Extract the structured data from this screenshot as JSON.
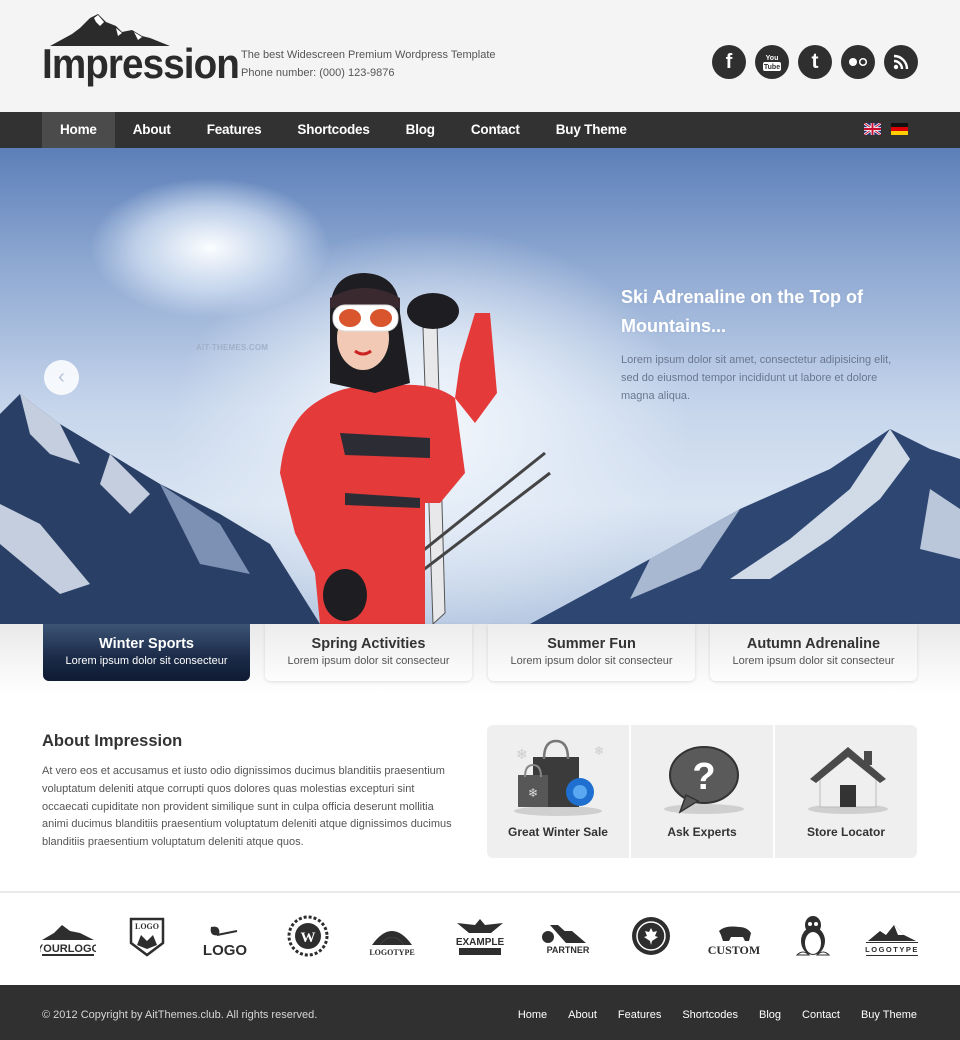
{
  "header": {
    "logo_text": "Impression",
    "tagline": "The best Widescreen Premium Wordpress Template",
    "phone": "Phone number: (000) 123-9876",
    "social": [
      {
        "name": "facebook-icon",
        "glyph": "f"
      },
      {
        "name": "youtube-icon",
        "glyph": "You Tube"
      },
      {
        "name": "twitter-icon",
        "glyph": "t"
      },
      {
        "name": "flickr-icon",
        "glyph": "●○"
      },
      {
        "name": "rss-icon",
        "glyph": "rss"
      }
    ]
  },
  "nav": {
    "items": [
      "Home",
      "About",
      "Features",
      "Shortcodes",
      "Blog",
      "Contact",
      "Buy Theme"
    ],
    "active": "Home",
    "languages": [
      "English",
      "German"
    ]
  },
  "hero": {
    "watermark": "AIT-THEMES.COM",
    "prev_glyph": "‹",
    "caption_title": "Ski Adrenaline on the Top of Mountains...",
    "caption_text": "Lorem ipsum dolor sit amet, consectetur adipisicing elit, sed do eiusmod tempor incididunt ut labore et dolore magna aliqua.",
    "colors": {
      "sky": "#8fa9d2",
      "suit": "#e53a3a"
    }
  },
  "tabs": [
    {
      "title": "Winter Sports",
      "subtitle": "Lorem ipsum dolor sit consecteur",
      "active": true
    },
    {
      "title": "Spring Activities",
      "subtitle": "Lorem ipsum dolor sit consecteur",
      "active": false
    },
    {
      "title": "Summer Fun",
      "subtitle": "Lorem ipsum dolor sit consecteur",
      "active": false
    },
    {
      "title": "Autumn Adrenaline",
      "subtitle": "Lorem ipsum dolor sit consecteur",
      "active": false
    }
  ],
  "about": {
    "title": "About Impression",
    "text": "At vero eos et accusamus et iusto odio dignissimos ducimus blanditiis praesentium voluptatum deleniti atque corrupti quos dolores quas molestias excepturi sint occaecati cupiditate non provident similique sunt in culpa officia deserunt mollitia animi ducimus blanditiis praesentium voluptatum deleniti atque dignissimos ducimus blanditiis praesentium voluptatum deleniti atque quos."
  },
  "features": [
    {
      "label": "Great Winter Sale",
      "icon": "shopping-bags-icon"
    },
    {
      "label": "Ask Experts",
      "icon": "question-bubble-icon"
    },
    {
      "label": "Store Locator",
      "icon": "house-icon"
    }
  ],
  "partners": [
    "YOURLOGO",
    "LOGO",
    "LOGO",
    "W",
    "LOGOTYPE",
    "EXAMPLE",
    "PARTNER",
    "maple-leaf",
    "CUSTOM",
    "penguin",
    "LOGOTYPE"
  ],
  "footer": {
    "copyright": "© 2012 Copyright by AitThemes.club. All rights reserved.",
    "links": [
      "Home",
      "About",
      "Features",
      "Shortcodes",
      "Blog",
      "Contact",
      "Buy Theme"
    ]
  }
}
